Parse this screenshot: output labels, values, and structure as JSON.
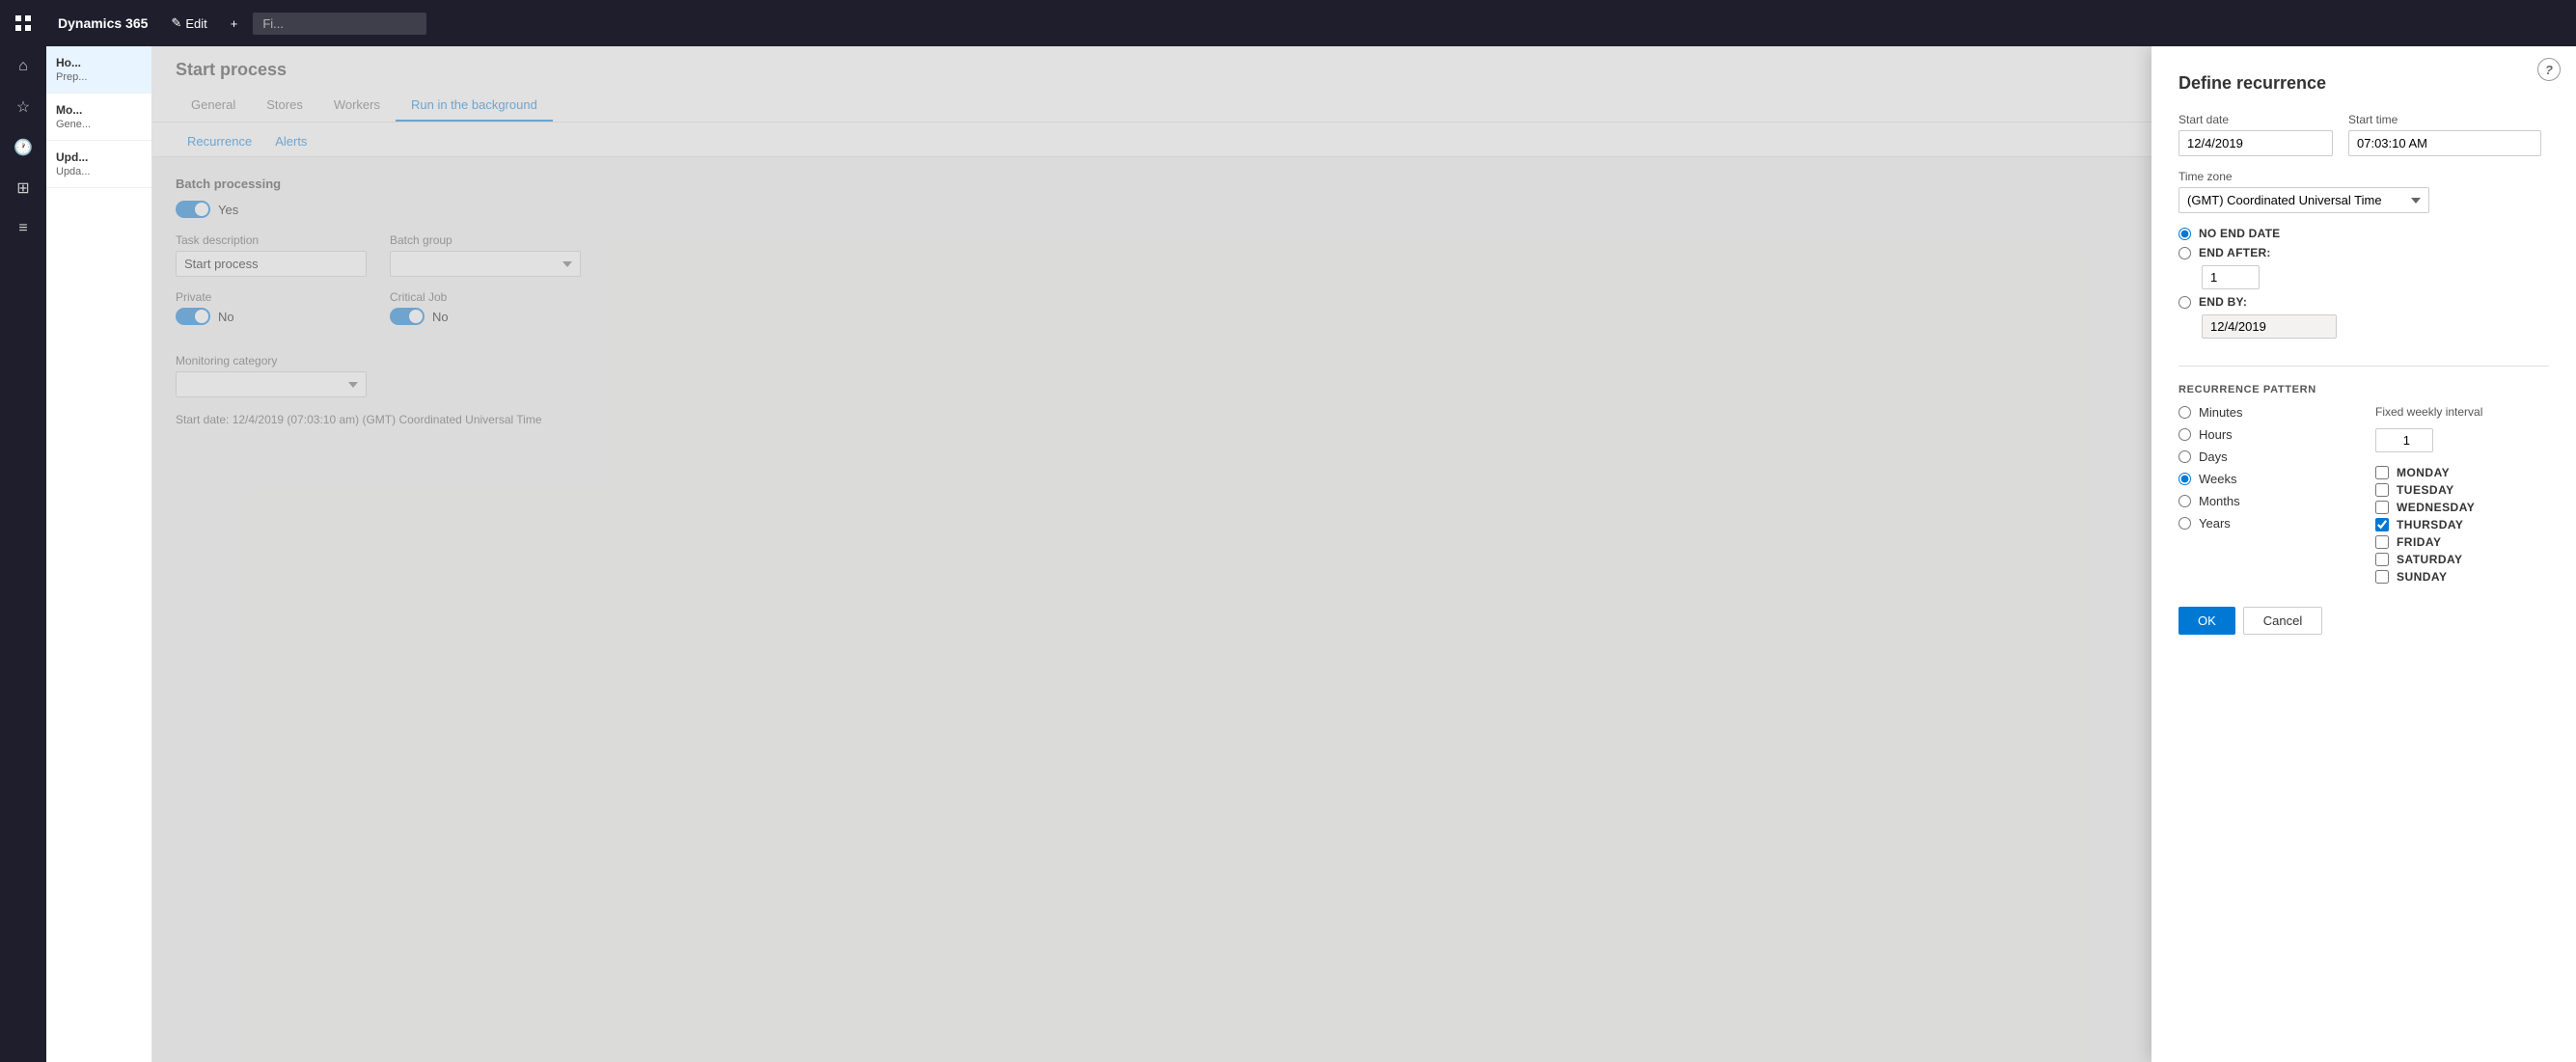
{
  "app": {
    "brand": "Dynamics 365",
    "top_buttons": [
      "Edit",
      "+"
    ]
  },
  "nav_icons": [
    "grid",
    "home",
    "star",
    "clock",
    "table",
    "list"
  ],
  "sidebar": {
    "items": [
      {
        "title": "Ho...",
        "sub": "Prep..."
      },
      {
        "title": "Mo...",
        "sub": "Gene..."
      },
      {
        "title": "Upd...",
        "sub": "Upda..."
      }
    ]
  },
  "start_process": {
    "title": "Start process",
    "tabs": [
      "General",
      "Stores",
      "Workers",
      "Run in the background"
    ],
    "active_tab": "Run in the background",
    "sub_tabs": [
      "Recurrence",
      "Alerts"
    ],
    "batch_processing": {
      "label": "Batch processing",
      "toggle": "Yes",
      "toggle_on": true
    },
    "task_description": {
      "label": "Task description",
      "value": "Start process"
    },
    "batch_group": {
      "label": "Batch group",
      "value": ""
    },
    "private": {
      "label": "Private",
      "value": "No",
      "toggle_on": true
    },
    "critical_job": {
      "label": "Critical Job",
      "value": "No",
      "toggle_on": true
    },
    "monitoring_category": {
      "label": "Monitoring category",
      "value": ""
    },
    "start_date_info": "Start date: 12/4/2019 (07:03:10 am) (GMT) Coordinated Universal Time"
  },
  "dialog": {
    "title": "Define recurrence",
    "start_date": {
      "label": "Start date",
      "value": "12/4/2019"
    },
    "start_time": {
      "label": "Start time",
      "value": "07:03:10 AM"
    },
    "time_zone": {
      "label": "Time zone",
      "value": "(GMT) Coordinated Universal Time",
      "options": [
        "(GMT) Coordinated Universal Time"
      ]
    },
    "end_options": {
      "no_end_date": "NO END DATE",
      "end_after": "END AFTER:",
      "end_after_value": 1,
      "end_by": "END BY:",
      "end_by_value": "12/4/2019",
      "selected": "no_end_date"
    },
    "recurrence_pattern": {
      "section_label": "RECURRENCE PATTERN",
      "patterns": [
        "Minutes",
        "Hours",
        "Days",
        "Weeks",
        "Months",
        "Years"
      ],
      "selected": "Weeks"
    },
    "weekly": {
      "interval_label": "Fixed weekly interval",
      "interval_value": 1,
      "days": [
        {
          "name": "MONDAY",
          "checked": false
        },
        {
          "name": "TUESDAY",
          "checked": false
        },
        {
          "name": "WEDNESDAY",
          "checked": false
        },
        {
          "name": "THURSDAY",
          "checked": true
        },
        {
          "name": "FRIDAY",
          "checked": false
        },
        {
          "name": "SATURDAY",
          "checked": false
        },
        {
          "name": "SUNDAY",
          "checked": false
        }
      ]
    },
    "buttons": {
      "ok": "OK",
      "cancel": "Cancel"
    }
  }
}
